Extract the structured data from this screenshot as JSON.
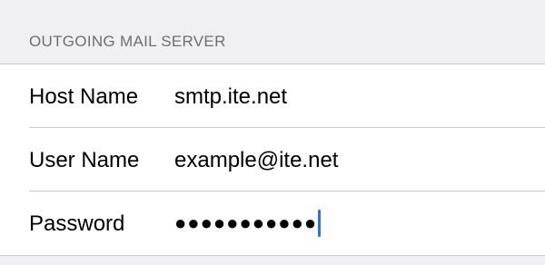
{
  "section": {
    "header": "OUTGOING MAIL SERVER"
  },
  "fields": {
    "host_name": {
      "label": "Host Name",
      "value": "smtp.ite.net"
    },
    "user_name": {
      "label": "User Name",
      "value": "example@ite.net"
    },
    "password": {
      "label": "Password",
      "masked_value": "●●●●●●●●●●●"
    }
  },
  "colors": {
    "background": "#efeff4",
    "cell": "#ffffff",
    "separator": "#c8c7cc",
    "header_text": "#6d6d72",
    "cursor": "#2f6ee8"
  }
}
